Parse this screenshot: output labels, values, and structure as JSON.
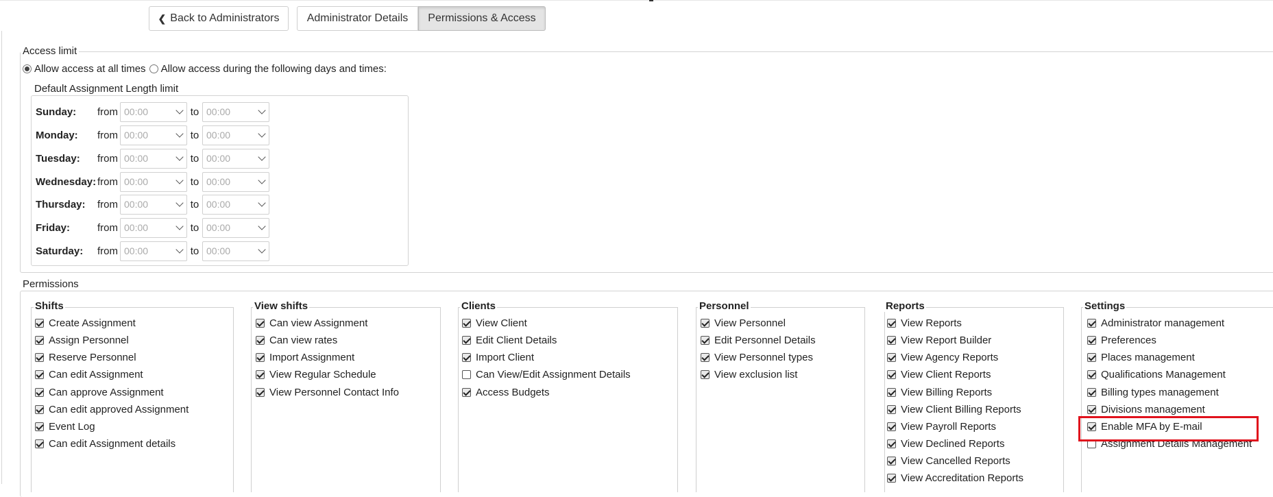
{
  "nav": {
    "back_label": "Back to Administrators",
    "tab_details": "Administrator Details",
    "tab_permissions": "Permissions & Access"
  },
  "access_limit": {
    "legend": "Access limit",
    "option_all": "Allow access at all times",
    "option_schedule": "Allow access during the following days and times:",
    "selected": "all",
    "schedule_legend": "Default Assignment Length limit",
    "from_label": "from",
    "to_label": "to",
    "days": [
      {
        "day": "Sunday:",
        "from": "00:00",
        "to": "00:00"
      },
      {
        "day": "Monday:",
        "from": "00:00",
        "to": "00:00"
      },
      {
        "day": "Tuesday:",
        "from": "00:00",
        "to": "00:00"
      },
      {
        "day": "Wednesday:",
        "from": "00:00",
        "to": "00:00"
      },
      {
        "day": "Thursday:",
        "from": "00:00",
        "to": "00:00"
      },
      {
        "day": "Friday:",
        "from": "00:00",
        "to": "00:00"
      },
      {
        "day": "Saturday:",
        "from": "00:00",
        "to": "00:00"
      }
    ]
  },
  "permissions": {
    "legend": "Permissions",
    "columns": [
      {
        "title": "Shifts",
        "items": [
          {
            "label": "Create Assignment",
            "checked": true
          },
          {
            "label": "Assign Personnel",
            "checked": true
          },
          {
            "label": "Reserve Personnel",
            "checked": true
          },
          {
            "label": "Can edit Assignment",
            "checked": true
          },
          {
            "label": "Can approve Assignment",
            "checked": true
          },
          {
            "label": "Can edit approved Assignment",
            "checked": true
          },
          {
            "label": "Event Log",
            "checked": true
          },
          {
            "label": "Can edit Assignment details",
            "checked": true
          }
        ]
      },
      {
        "title": "View shifts",
        "items": [
          {
            "label": "Can view Assignment",
            "checked": true
          },
          {
            "label": "Can view rates",
            "checked": true
          },
          {
            "label": "Import Assignment",
            "checked": true
          },
          {
            "label": "View Regular Schedule",
            "checked": true
          },
          {
            "label": "View Personnel Contact Info",
            "checked": true
          }
        ]
      },
      {
        "title": "Clients",
        "items": [
          {
            "label": "View Client",
            "checked": true
          },
          {
            "label": "Edit Client Details",
            "checked": true
          },
          {
            "label": "Import Client",
            "checked": true
          },
          {
            "label": "Can View/Edit Assignment Details",
            "checked": false
          },
          {
            "label": "Access Budgets",
            "checked": true
          }
        ]
      },
      {
        "title": "Personnel",
        "items": [
          {
            "label": "View Personnel",
            "checked": true
          },
          {
            "label": "Edit Personnel Details",
            "checked": true
          },
          {
            "label": "View Personnel types",
            "checked": true
          },
          {
            "label": "View exclusion list",
            "checked": true
          }
        ]
      },
      {
        "title": "Reports",
        "items": [
          {
            "label": "View Reports",
            "checked": true
          },
          {
            "label": "View Report Builder",
            "checked": true
          },
          {
            "label": "View Agency Reports",
            "checked": true
          },
          {
            "label": "View Client Reports",
            "checked": true
          },
          {
            "label": "View Billing Reports",
            "checked": true
          },
          {
            "label": "View Client Billing Reports",
            "checked": true
          },
          {
            "label": "View Payroll Reports",
            "checked": true
          },
          {
            "label": "View Declined Reports",
            "checked": true
          },
          {
            "label": "View Cancelled Reports",
            "checked": true
          },
          {
            "label": "View Accreditation Reports",
            "checked": true
          }
        ]
      },
      {
        "title": "Settings",
        "items": [
          {
            "label": "Administrator management",
            "checked": true
          },
          {
            "label": "Preferences",
            "checked": true
          },
          {
            "label": "Places management",
            "checked": true
          },
          {
            "label": "Qualifications Management",
            "checked": true
          },
          {
            "label": "Billing types management",
            "checked": true
          },
          {
            "label": "Divisions management",
            "checked": true
          },
          {
            "label": "Enable MFA by E-mail",
            "checked": true
          },
          {
            "label": "Assignment Details Management",
            "checked": false
          }
        ]
      }
    ]
  },
  "highlight_color": "#e0111c"
}
